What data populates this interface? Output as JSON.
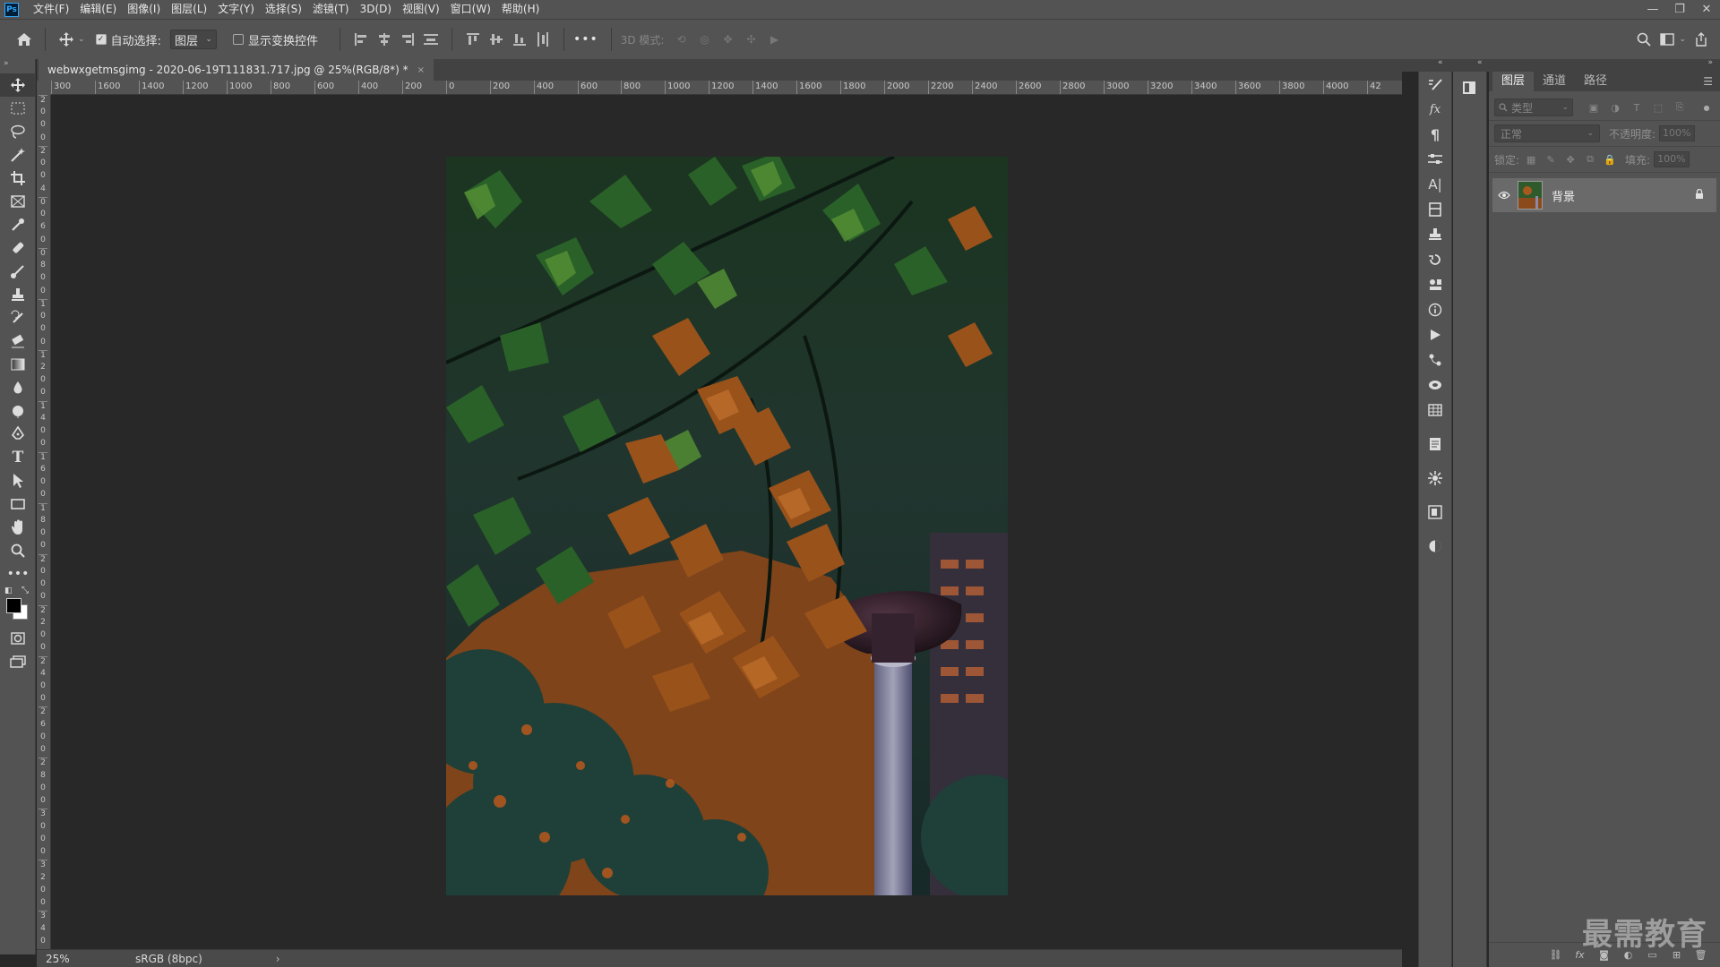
{
  "app": {
    "logo": "Ps",
    "menu": [
      "文件(F)",
      "编辑(E)",
      "图像(I)",
      "图层(L)",
      "文字(Y)",
      "选择(S)",
      "滤镜(T)",
      "3D(D)",
      "视图(V)",
      "窗口(W)",
      "帮助(H)"
    ],
    "window_controls": [
      "—",
      "❐",
      "✕"
    ]
  },
  "options": {
    "auto_select_label": "自动选择:",
    "auto_select_checked": true,
    "auto_select_target": "图层",
    "show_transform_label": "显示变换控件",
    "show_transform_checked": false,
    "more": "•••",
    "mode_3d_label": "3D 模式:"
  },
  "document": {
    "tab_title": "webwxgetmsgimg - 2020-06-19T111831.717.jpg @ 25%(RGB/8*) *",
    "close": "×",
    "ruler_h": [
      "300",
      "1600",
      "1400",
      "1200",
      "1000",
      "800",
      "600",
      "400",
      "200",
      "0",
      "200",
      "400",
      "600",
      "800",
      "1000",
      "1200",
      "1400",
      "1600",
      "1800",
      "2000",
      "2200",
      "2400",
      "2600",
      "2800",
      "3000",
      "3200",
      "3400",
      "3600",
      "3800",
      "4000",
      "42"
    ],
    "ruler_v": [
      "2",
      "0",
      "0",
      "0",
      "2",
      "0",
      "0",
      "4",
      "0",
      "0",
      "6",
      "0",
      "0",
      "8",
      "0",
      "0",
      "1",
      "0",
      "0",
      "0",
      "1",
      "2",
      "0",
      "0",
      "1",
      "4",
      "0",
      "0",
      "1",
      "6",
      "0",
      "0",
      "1",
      "8",
      "0",
      "0",
      "2",
      "0",
      "0",
      "0",
      "2",
      "2",
      "0",
      "0",
      "2",
      "4",
      "0",
      "0",
      "2",
      "6",
      "0",
      "0",
      "2",
      "8",
      "0",
      "0",
      "3",
      "0",
      "0",
      "0",
      "3",
      "2",
      "0",
      "0",
      "3",
      "4",
      "0"
    ]
  },
  "status": {
    "zoom": "25%",
    "profile": "sRGB (8bpc)",
    "arrow": "›"
  },
  "layers_panel": {
    "tabs": [
      "图层",
      "通道",
      "路径"
    ],
    "active_tab": 0,
    "search_placeholder": "类型",
    "blend_mode": "正常",
    "opacity_label": "不透明度:",
    "opacity_value": "100%",
    "lock_label": "锁定:",
    "fill_label": "填充:",
    "fill_value": "100%",
    "layers": [
      {
        "name": "背景",
        "visible": true,
        "locked": true
      }
    ],
    "footer_buttons": [
      "⛓",
      "fx",
      "◙",
      "◐",
      "▭",
      "⊞",
      "🗑"
    ]
  },
  "watermark": "最需教育"
}
